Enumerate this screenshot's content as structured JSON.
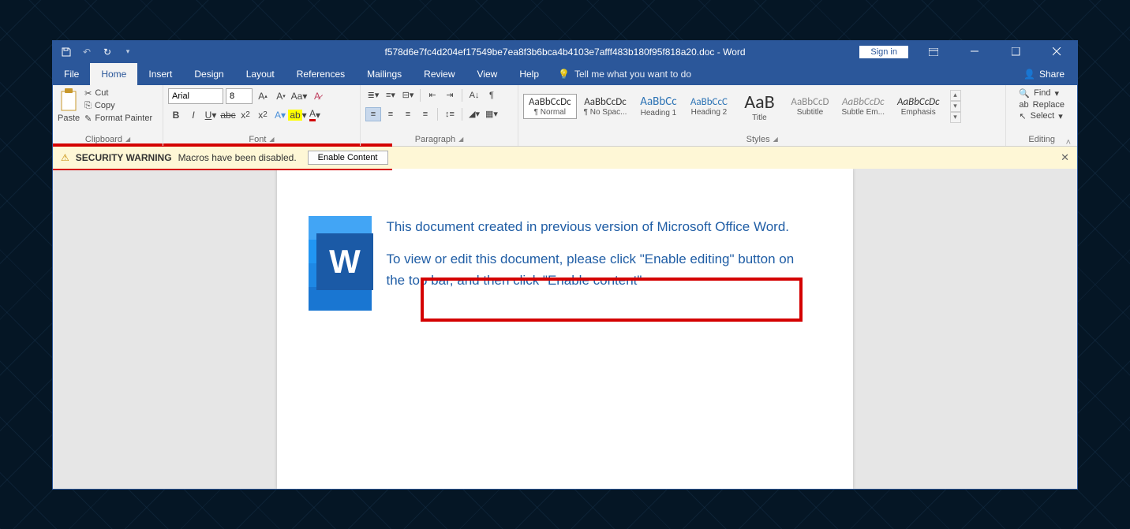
{
  "title": "f578d6e7fc4d204ef17549be7ea8f3b6bca4b4103e7afff483b180f95f818a20.doc  -  Word",
  "signin": "Sign in",
  "tabs": [
    "File",
    "Home",
    "Insert",
    "Design",
    "Layout",
    "References",
    "Mailings",
    "Review",
    "View",
    "Help"
  ],
  "activeTab": "Home",
  "tellme": "Tell me what you want to do",
  "share": "Share",
  "clipboard": {
    "paste": "Paste",
    "cut": "Cut",
    "copy": "Copy",
    "fmt": "Format Painter",
    "label": "Clipboard"
  },
  "font": {
    "name": "Arial",
    "size": "8",
    "label": "Font"
  },
  "paragraph": {
    "label": "Paragraph"
  },
  "styles": {
    "label": "Styles",
    "items": [
      {
        "prev": "AaBbCcDc",
        "name": "¶ Normal",
        "sel": true
      },
      {
        "prev": "AaBbCcDc",
        "name": "¶ No Spac..."
      },
      {
        "prev": "AaBbCc",
        "name": "Heading 1",
        "cls": "h1"
      },
      {
        "prev": "AaBbCcC",
        "name": "Heading 2",
        "cls": "h2"
      },
      {
        "prev": "AaB",
        "name": "Title",
        "cls": "ti"
      },
      {
        "prev": "AaBbCcD",
        "name": "Subtitle",
        "cls": "sub"
      },
      {
        "prev": "AaBbCcDc",
        "name": "Subtle Em...",
        "cls": "se"
      },
      {
        "prev": "AaBbCcDc",
        "name": "Emphasis",
        "cls": "em"
      }
    ]
  },
  "editing": {
    "find": "Find",
    "replace": "Replace",
    "select": "Select",
    "label": "Editing"
  },
  "security": {
    "title": "SECURITY WARNING",
    "msg": "Macros have been disabled.",
    "btn": "Enable Content"
  },
  "doc": {
    "line1": "This document created in previous version of Microsoft Office Word.",
    "line2": "To view or edit this document, please click \"Enable editing\" button on the top bar, and then click \"Enable content\""
  }
}
